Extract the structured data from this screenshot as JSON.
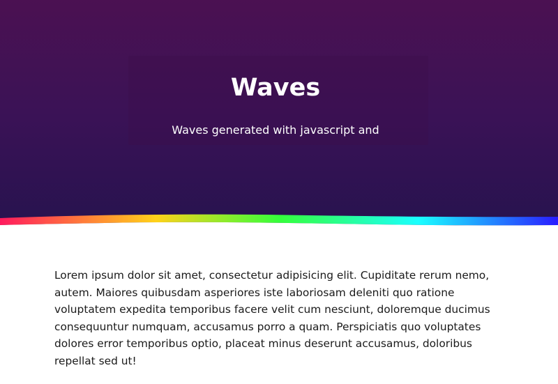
{
  "hero": {
    "title": "Waves",
    "subtitle": "Waves generated with javascript and"
  },
  "content": {
    "paragraph": "Lorem ipsum dolor sit amet, consectetur adipisicing elit. Cupiditate rerum nemo, autem. Maiores quibusdam asperiores iste laboriosam deleniti quo ratione voluptatem expedita temporibus facere velit cum nesciunt, doloremque ducimus consequuntur numquam, accusamus porro a quam. Perspiciatis quo voluptates dolores error temporibus optio, placeat minus deserunt accusamus, doloribus repellat sed ut!"
  },
  "colors": {
    "hero_top": "#4b1152",
    "hero_bottom": "#25134e",
    "wave_gradient": [
      "#ff1a5e",
      "#ffd21a",
      "#35ff3a",
      "#1affff",
      "#2a1aff"
    ],
    "text": "#1a1a1a"
  }
}
